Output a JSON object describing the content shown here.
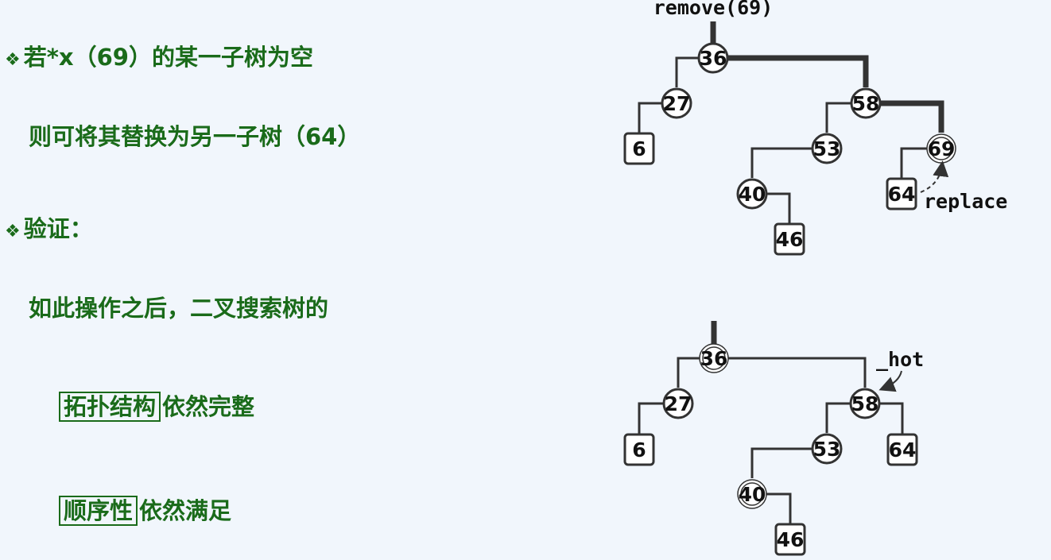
{
  "text": {
    "bullet_symbol": "❖",
    "line1": "若*x（69）的某一子树为空",
    "line2": "则可将其替换为另一子树（64）",
    "line3": "验证：",
    "line4": "如此操作之后，二叉搜索树的",
    "line5_boxed": "拓扑结构",
    "line5_rest": "依然完整",
    "line6_boxed": "顺序性",
    "line6_rest": "依然满足"
  },
  "colors": {
    "text_green": "#1a6b1a",
    "background": "#f1f6fc",
    "tree_line": "#333333"
  },
  "tree_before": {
    "op_label": "remove(69)",
    "annotation": "replace",
    "nodes": [
      {
        "id": "36",
        "label": "36",
        "kind": "internal"
      },
      {
        "id": "27",
        "label": "27",
        "kind": "internal"
      },
      {
        "id": "58",
        "label": "58",
        "kind": "internal"
      },
      {
        "id": "6",
        "label": "6",
        "kind": "leaf"
      },
      {
        "id": "53",
        "label": "53",
        "kind": "internal"
      },
      {
        "id": "69",
        "label": "69",
        "kind": "target"
      },
      {
        "id": "40",
        "label": "40",
        "kind": "internal"
      },
      {
        "id": "64",
        "label": "64",
        "kind": "leaf"
      },
      {
        "id": "46",
        "label": "46",
        "kind": "leaf"
      }
    ]
  },
  "tree_after": {
    "annotation": "_hot",
    "nodes": [
      {
        "id": "36",
        "label": "36",
        "kind": "target"
      },
      {
        "id": "27",
        "label": "27",
        "kind": "internal"
      },
      {
        "id": "58",
        "label": "58",
        "kind": "internal"
      },
      {
        "id": "6",
        "label": "6",
        "kind": "leaf"
      },
      {
        "id": "53",
        "label": "53",
        "kind": "internal"
      },
      {
        "id": "64",
        "label": "64",
        "kind": "leaf"
      },
      {
        "id": "40",
        "label": "40",
        "kind": "target"
      },
      {
        "id": "46",
        "label": "46",
        "kind": "leaf"
      }
    ]
  }
}
